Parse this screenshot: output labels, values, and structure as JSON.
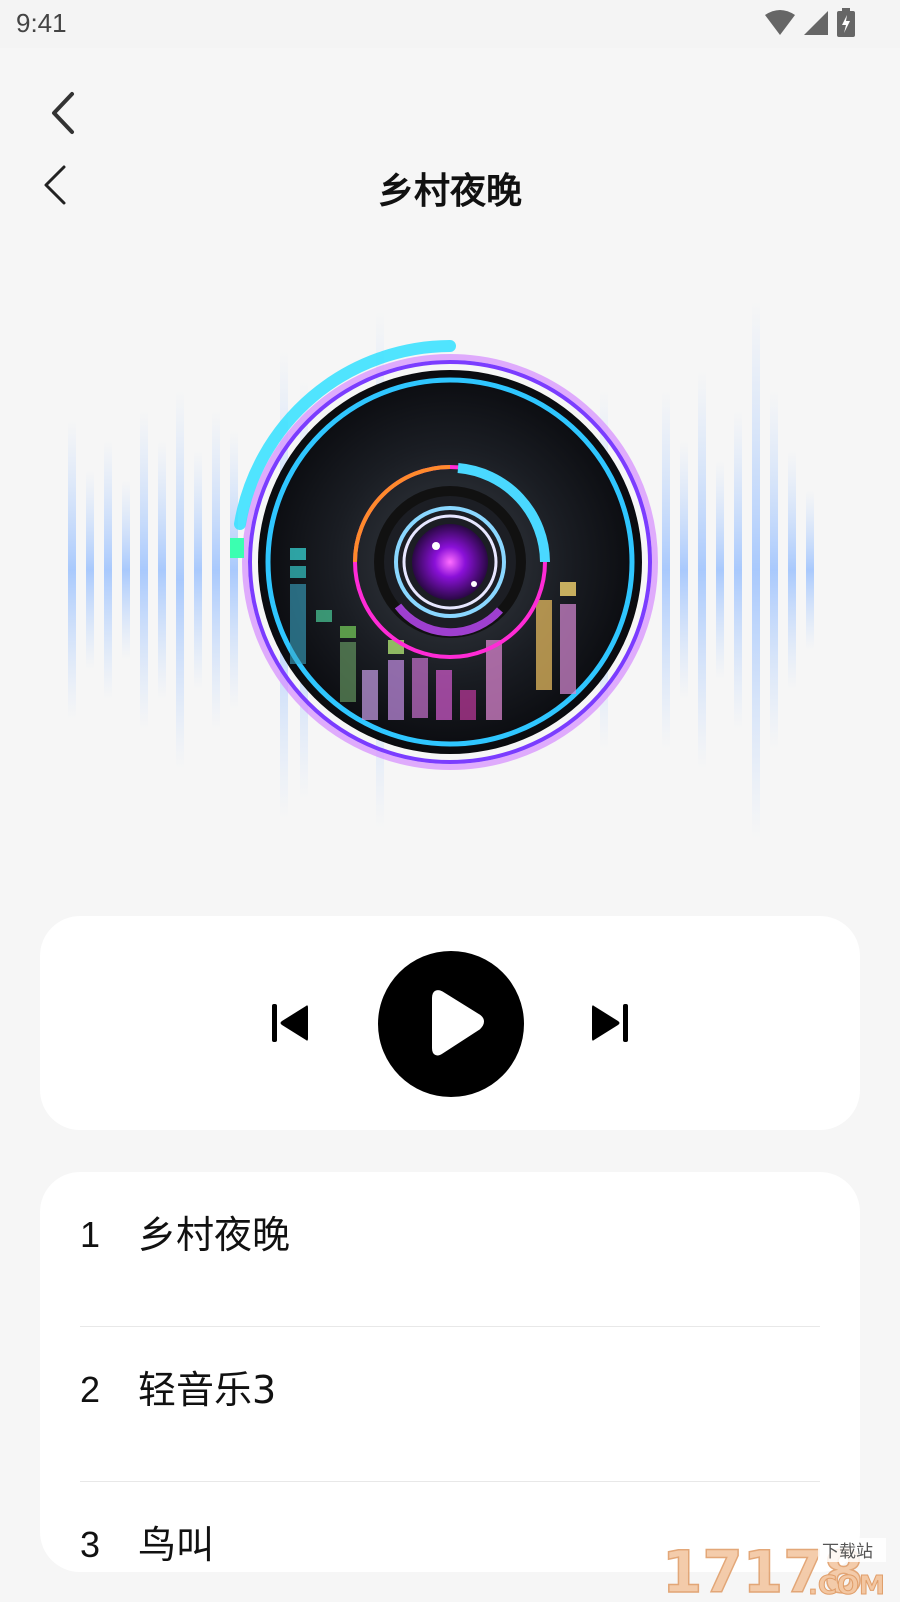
{
  "status_bar": {
    "time": "9:41",
    "icons": [
      "wifi-icon",
      "signal-icon",
      "battery-icon"
    ]
  },
  "header": {
    "title": "乡村夜晚",
    "back_icon": "chevron-left-icon"
  },
  "player": {
    "controls": [
      "previous-track-icon",
      "play-icon",
      "next-track-icon"
    ],
    "accent_colors": [
      "#1fd7ff",
      "#7b3cff",
      "#ff2bd6",
      "#a9ff6e"
    ]
  },
  "tracks": [
    {
      "number": "1",
      "name": "乡村夜晚"
    },
    {
      "number": "2",
      "name": "轻音乐3"
    },
    {
      "number": "3",
      "name": "鸟叫"
    }
  ],
  "watermark": {
    "brand": "17178",
    "suffix": ".COM",
    "tag": "下载站"
  }
}
